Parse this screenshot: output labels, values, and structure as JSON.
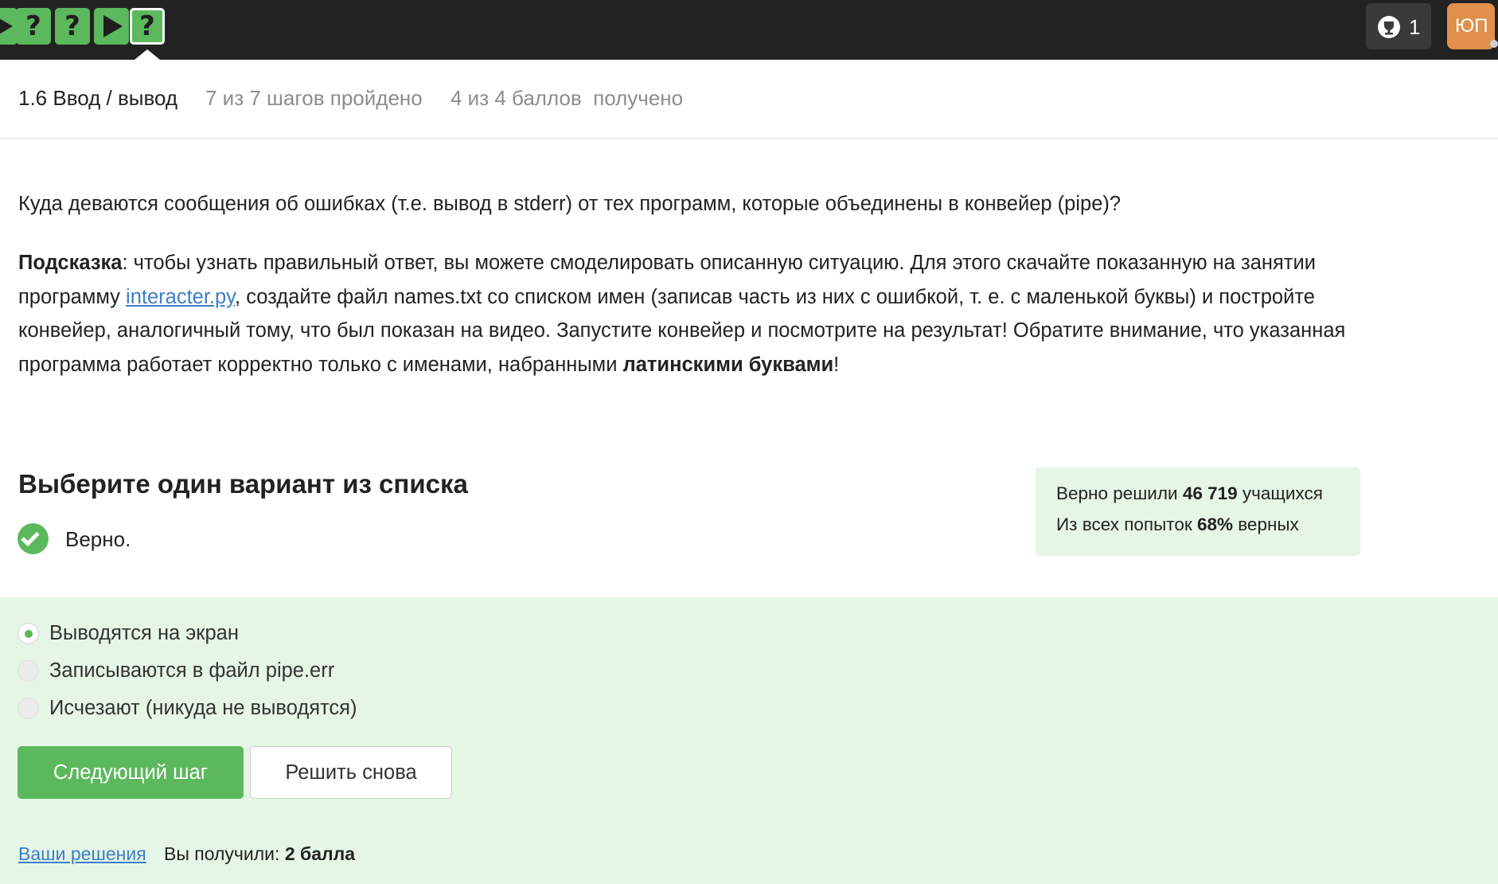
{
  "topbar": {
    "steps": [
      {
        "kind": "play",
        "state": "passed"
      },
      {
        "kind": "question",
        "label": "?",
        "state": "passed"
      },
      {
        "kind": "question",
        "label": "?",
        "state": "passed"
      },
      {
        "kind": "play",
        "state": "passed"
      },
      {
        "kind": "question",
        "label": "?",
        "state": "current"
      }
    ],
    "award_count": "1",
    "avatar_initials": "ЮП"
  },
  "lesson": {
    "title": "1.6 Ввод / вывод",
    "steps_progress": "7 из 7 шагов пройдено",
    "points_progress": "4 из 4 баллов  получено"
  },
  "question": {
    "text": "Куда деваются сообщения об ошибках (т.е. вывод в stderr) от тех программ, которые объединены в конвейер (pipe)?",
    "hint_label": "Подсказка",
    "hint_part1": ": чтобы узнать правильный ответ, вы можете смоделировать описанную ситуацию. Для этого скачайте показанную на занятии программу ",
    "hint_link": "interacter.py",
    "hint_part2": ", создайте файл names.txt со списком имен (записав часть из них с ошибкой, т. е. с маленькой буквы) и постройте конвейер, аналогичный тому, что был показан на видео. Запустите конвейер и посмотрите на результат! Обратите внимание, что указанная программа работает корректно только с именами, набранными ",
    "hint_bold": "латинскими буквами",
    "hint_end": "!"
  },
  "quiz": {
    "title": "Выберите один вариант из списка",
    "verdict": "Верно.",
    "options": [
      {
        "label": "Выводятся на экран",
        "selected": true
      },
      {
        "label": "Записываются в файл pipe.err",
        "selected": false
      },
      {
        "label": "Исчезают (никуда не выводятся)",
        "selected": false
      }
    ],
    "next_button": "Следующий шаг",
    "retry_button": "Решить снова"
  },
  "stats": {
    "solved_prefix": "Верно решили ",
    "solved_count": "46 719",
    "solved_suffix": " учащихся",
    "attempts_prefix": "Из всех попыток ",
    "attempts_percent": "68%",
    "attempts_suffix": " верных"
  },
  "footer": {
    "solutions_link": "Ваши решения",
    "score_prefix": "Вы получили: ",
    "score_value": "2 балла"
  },
  "colors": {
    "topbar": "#222222",
    "accent_green": "#5cb85c",
    "success_bg": "#e6f6e6",
    "link_blue": "#3d7ec9",
    "avatar_bg": "#e0904a"
  }
}
